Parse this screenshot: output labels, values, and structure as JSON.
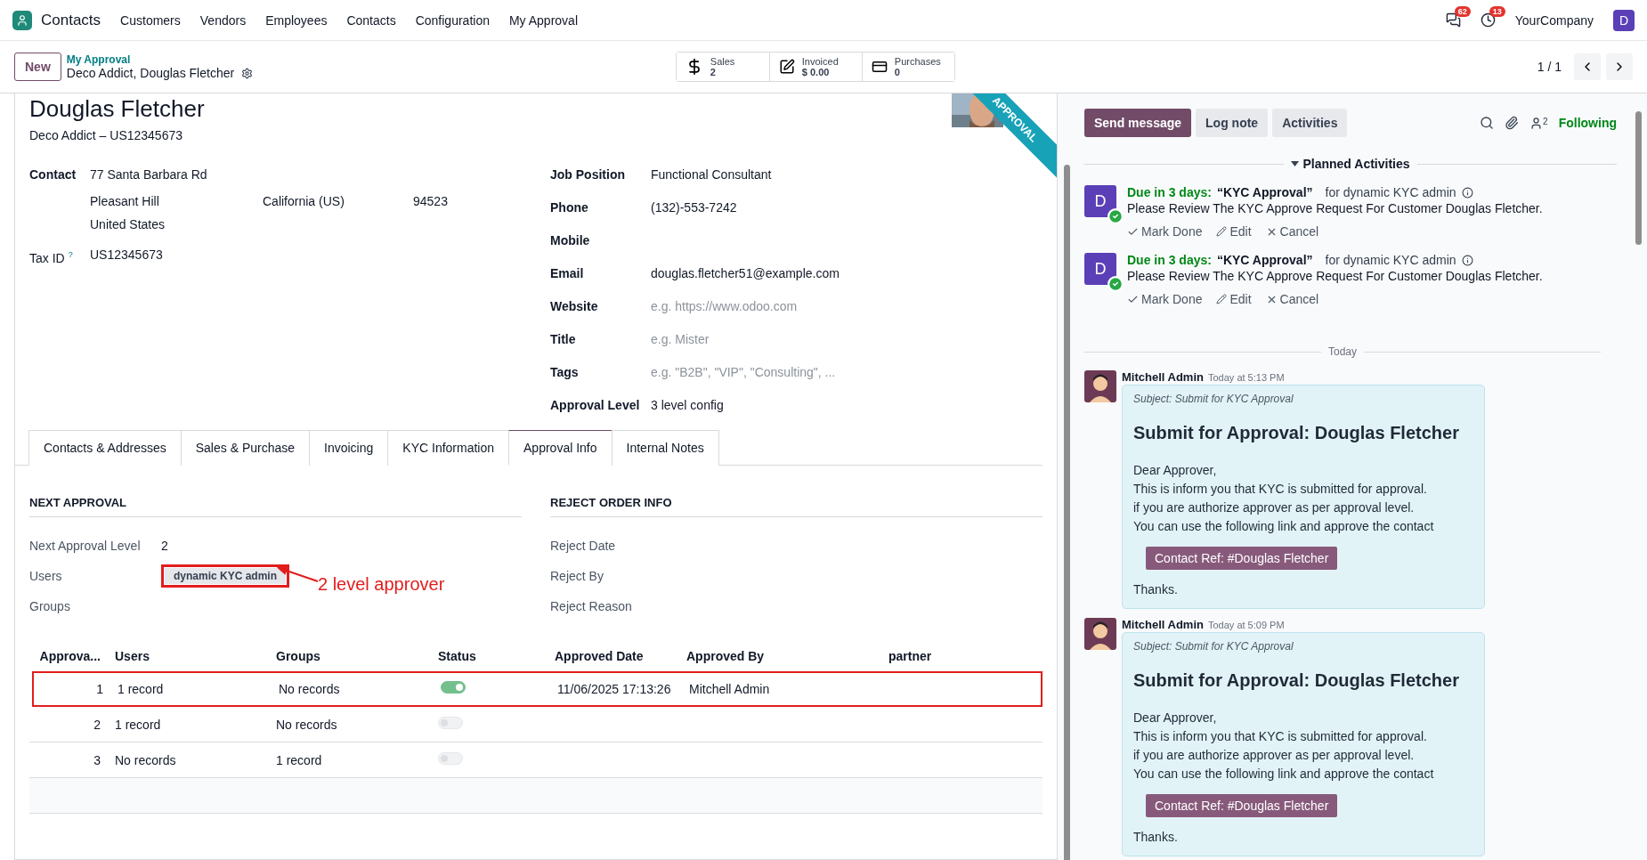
{
  "navbar": {
    "app": "Contacts",
    "menu": [
      "Customers",
      "Vendors",
      "Employees",
      "Contacts",
      "Configuration",
      "My Approval"
    ],
    "messages_count": "62",
    "activities_count": "13",
    "company": "YourCompany",
    "user_initial": "D"
  },
  "control_panel": {
    "new_button": "New",
    "breadcrumb": "My Approval",
    "record": "Deco Addict, Douglas Fletcher",
    "pager": "1 / 1",
    "stat_buttons": [
      {
        "kind": "dollar",
        "label": "Sales",
        "value": "2"
      },
      {
        "kind": "invoice",
        "label": "Invoiced",
        "value": "$ 0.00"
      },
      {
        "kind": "card",
        "label": "Purchases",
        "value": "0"
      }
    ]
  },
  "form": {
    "title": "Douglas Fletcher",
    "ribbon": "APPROVAL",
    "subtitle": "Deco Addict – US12345673",
    "address": {
      "label": "Contact",
      "street": "77 Santa Barbara Rd",
      "city": "Pleasant Hill",
      "state": "California (US)",
      "zip": "94523",
      "country": "United States"
    },
    "tax_id": {
      "label": "Tax ID",
      "help": "?",
      "value": "US12345673"
    },
    "right_fields": [
      {
        "label": "Job Position",
        "value": "Functional Consultant"
      },
      {
        "label": "Phone",
        "value": "(132)-553-7242"
      },
      {
        "label": "Mobile"
      },
      {
        "label": "Email",
        "value": "douglas.fletcher51@example.com"
      },
      {
        "label": "Website",
        "placeholder": "e.g. https://www.odoo.com"
      },
      {
        "label": "Title",
        "placeholder": "e.g. Mister"
      },
      {
        "label": "Tags",
        "placeholder": "e.g. \"B2B\", \"VIP\", \"Consulting\", ..."
      },
      {
        "label": "Approval Level",
        "value": "3 level config"
      }
    ],
    "tabs": [
      {
        "label": "Contacts & Addresses",
        "selected": false
      },
      {
        "label": "Sales & Purchase",
        "selected": false
      },
      {
        "label": "Invoicing",
        "selected": false
      },
      {
        "label": "KYC Information",
        "selected": false
      },
      {
        "label": "Approval Info",
        "selected": true
      },
      {
        "label": "Internal Notes",
        "selected": false
      }
    ],
    "next_approval": {
      "heading": "NEXT APPROVAL",
      "level_label": "Next Approval Level",
      "level_value": "2",
      "users_label": "Users",
      "users_tag": "dynamic KYC admin",
      "groups_label": "Groups",
      "annotation": "2 level approver"
    },
    "reject_info": {
      "heading": "REJECT ORDER INFO",
      "fields": [
        "Reject Date",
        "Reject By",
        "Reject Reason"
      ]
    },
    "approval_table": {
      "columns": [
        "Approva...",
        "Users",
        "Groups",
        "Status",
        "Approved Date",
        "Approved By",
        "partner"
      ],
      "rows": [
        {
          "level": "1",
          "users": "1 record",
          "groups": "No records",
          "on": true,
          "approved_date": "11/06/2025 17:13:26",
          "approved_by": "Mitchell Admin",
          "highlighted": true
        },
        {
          "level": "2",
          "users": "1 record",
          "groups": "No records",
          "on": false,
          "highlighted": false
        },
        {
          "level": "3",
          "users": "No records",
          "groups": "1 record",
          "on": false,
          "highlighted": false
        }
      ]
    }
  },
  "chatter": {
    "buttons": [
      {
        "label": "Send message",
        "selected": true
      },
      {
        "label": "Log note",
        "selected": false
      },
      {
        "label": "Activities",
        "selected": false
      }
    ],
    "followers_count": "2",
    "following": "Following",
    "planned_heading": "Planned Activities",
    "activities": [
      {
        "avatar": "D",
        "due": "Due in 3 days:",
        "title": "“KYC Approval”",
        "assignee": "for dynamic KYC admin",
        "note": "Please Review The KYC Approve Request For Customer Douglas Fletcher.",
        "actions": [
          {
            "kind": "done",
            "label": "Mark Done"
          },
          {
            "kind": "edit",
            "label": "Edit"
          },
          {
            "kind": "cancel",
            "label": "Cancel"
          }
        ]
      },
      {
        "avatar": "D",
        "due": "Due in 3 days:",
        "title": "“KYC Approval”",
        "assignee": "for dynamic KYC admin",
        "note": "Please Review The KYC Approve Request For Customer Douglas Fletcher.",
        "actions": [
          {
            "kind": "done",
            "label": "Mark Done"
          },
          {
            "kind": "edit",
            "label": "Edit"
          },
          {
            "kind": "cancel",
            "label": "Cancel"
          }
        ]
      }
    ],
    "date_separator": "Today",
    "messages": [
      {
        "author": "Mitchell Admin",
        "time": "Today at 5:13 PM",
        "subject": "Subject: Submit for KYC Approval",
        "heading": "Submit for Approval: Douglas Fletcher",
        "lines": [
          "Dear Approver,",
          "This is inform you that KYC is submitted for approval.",
          "if you are authorize approver as per approval level.",
          "You can use the following link and approve the contact"
        ],
        "link": "Contact Ref: #Douglas Fletcher",
        "closing": "Thanks."
      },
      {
        "author": "Mitchell Admin",
        "time": "Today at 5:09 PM",
        "subject": "Subject: Submit for KYC Approval",
        "heading": "Submit for Approval: Douglas Fletcher",
        "lines": [
          "Dear Approver,",
          "This is inform you that KYC is submitted for approval.",
          "if you are authorize approver as per approval level.",
          "You can use the following link and approve the contact"
        ],
        "link": "Contact Ref: #Douglas Fletcher",
        "closing": "Thanks."
      }
    ]
  }
}
